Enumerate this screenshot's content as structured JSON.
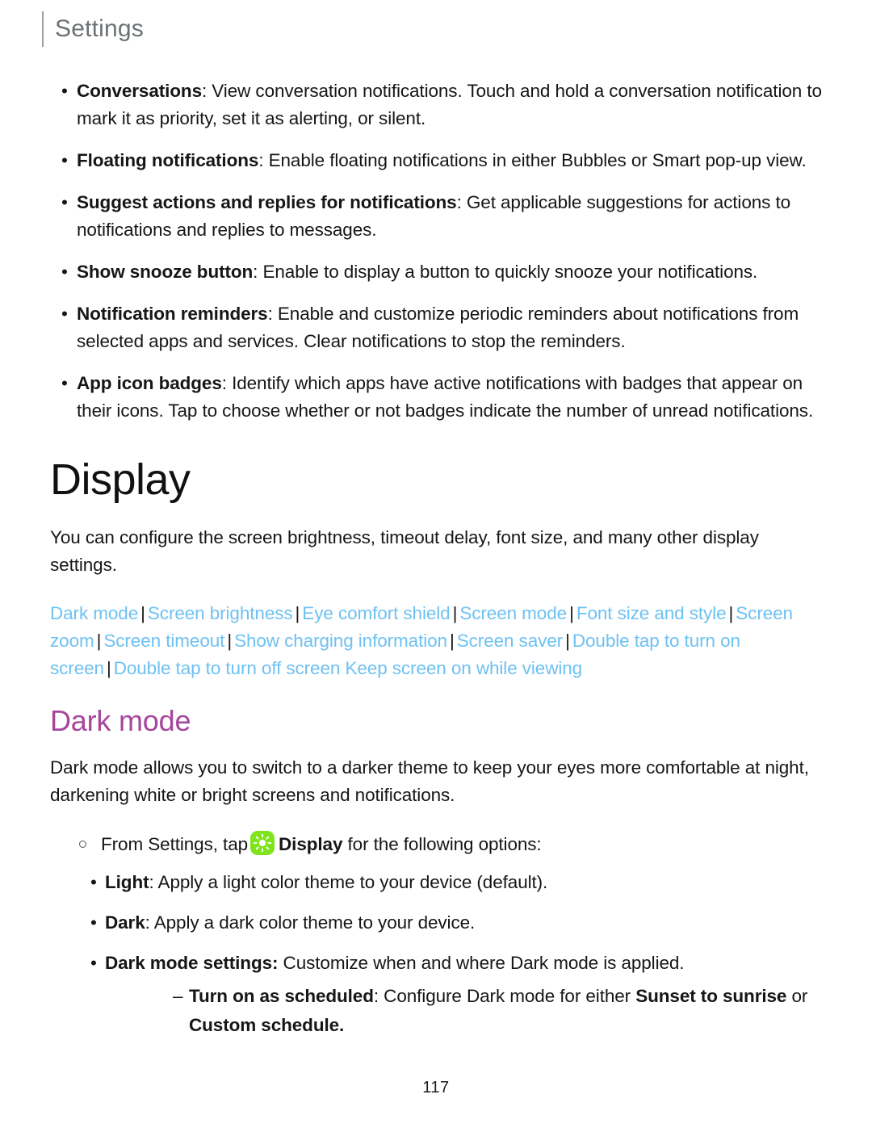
{
  "header": {
    "title": "Settings"
  },
  "notifications_bullets": [
    {
      "term": "Conversations",
      "colon": ":",
      "text": " View conversation notifications. Touch and hold a conversation notification to mark it as priority, set it as alerting, or silent."
    },
    {
      "term": "Floating notifications",
      "colon": ":",
      "text": " Enable floating notifications in either Bubbles or Smart pop-up view."
    },
    {
      "term": "Suggest actions and replies for notifications",
      "colon": ":",
      "text": " Get applicable suggestions for actions to notifications and replies to messages."
    },
    {
      "term": "Show snooze button",
      "colon": ":",
      "text": " Enable to display a button to quickly snooze your notifications."
    },
    {
      "term": "Notification reminders",
      "colon": ":",
      "text": " Enable and customize periodic reminders about notifications from selected apps and services. Clear notifications to stop the reminders."
    },
    {
      "term": "App icon badges",
      "colon": ":",
      "text": " Identify which apps have active notifications with badges that appear on their icons. Tap to choose whether or not badges indicate the number of unread notifications."
    }
  ],
  "display_section": {
    "heading": "Display",
    "intro": "You can configure the screen brightness, timeout delay, font size, and many other display settings.",
    "links": [
      {
        "label": "Dark mode",
        "separator_after": true
      },
      {
        "label": "Screen brightness",
        "separator_after": true
      },
      {
        "label": "Eye comfort shield",
        "separator_after": true
      },
      {
        "label": "Screen mode",
        "separator_after": true
      },
      {
        "label": "Font size and style",
        "separator_after": true
      },
      {
        "label": "Screen zoom",
        "separator_after": true
      },
      {
        "label": "Screen timeout",
        "separator_after": true
      },
      {
        "label": "Show charging information",
        "separator_after": true
      },
      {
        "label": "Screen saver",
        "separator_after": true
      },
      {
        "label": "Double tap to turn on screen",
        "separator_after": true
      },
      {
        "label": "Double tap to turn off screen",
        "separator_after": false
      },
      {
        "label": "Keep screen on while viewing",
        "separator_after": false
      }
    ],
    "separator_glyph": "|"
  },
  "dark_mode_section": {
    "heading": "Dark mode",
    "intro": "Dark mode allows you to switch to a darker theme to keep your eyes more comfortable at night, darkening white or bright screens and notifications.",
    "step": {
      "prefix": "From Settings, tap",
      "icon_name": "display-settings-icon",
      "icon_color": "#7ee41c",
      "icon_label": "Display",
      "suffix": " for the following options:"
    },
    "options": [
      {
        "term": "Light",
        "colon": ":",
        "text": " Apply a light color theme to your device (default)."
      },
      {
        "term": "Dark",
        "colon": ":",
        "text": " Apply a dark color theme to your device."
      },
      {
        "term": "Dark mode settings:",
        "colon": "",
        "text": " Customize when and where Dark mode is applied."
      }
    ],
    "sub_option": {
      "term": "Turn on as scheduled",
      "colon": ":",
      "text_before": " Configure Dark mode for either ",
      "bold_a": "Sunset to sunrise",
      "text_middle": " or ",
      "bold_b": "Custom schedule."
    }
  },
  "footer": {
    "page_number": "117"
  },
  "colors": {
    "link": "#6ec1f2",
    "subheading": "#a6459c",
    "header_text": "#6d7275",
    "icon_green": "#7ee41c"
  }
}
